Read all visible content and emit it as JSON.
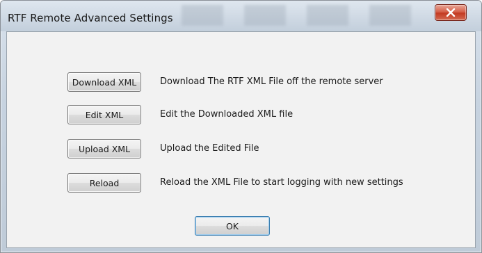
{
  "window": {
    "title": "RTF Remote Advanced Settings",
    "close_icon": "close-icon"
  },
  "actions": [
    {
      "button_label": "Download XML",
      "description": "Download The RTF XML File off the remote server"
    },
    {
      "button_label": "Edit XML",
      "description": "Edit the Downloaded XML file"
    },
    {
      "button_label": "Upload XML",
      "description": "Upload the Edited File"
    },
    {
      "button_label": "Reload",
      "description": "Reload the XML File to start logging with new settings"
    }
  ],
  "footer": {
    "ok_label": "OK"
  },
  "colors": {
    "close_button": "#c33a22",
    "default_button_border": "#3c7fb1"
  }
}
